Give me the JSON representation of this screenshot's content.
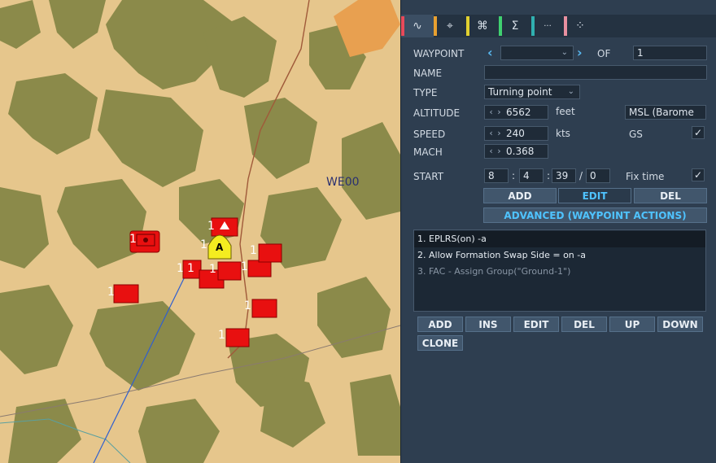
{
  "map": {
    "label_we00": "WE00",
    "unit_number": "1",
    "waypoint_marker": "A",
    "colors": {
      "sand": "#e6c68c",
      "vegetation": "#8b8a4a",
      "unit": "#e81010",
      "road": "#a05a3a",
      "route": "#2f5fd0"
    }
  },
  "tabs": [
    {
      "icon": "route-icon",
      "glyph": "∿",
      "color": "#e84a5a"
    },
    {
      "icon": "target-icon",
      "glyph": "⌖",
      "color": "#e8a030"
    },
    {
      "icon": "formation-icon",
      "glyph": "⌘",
      "color": "#e0d030"
    },
    {
      "icon": "sum-icon",
      "glyph": "Σ",
      "color": "#40d070"
    },
    {
      "icon": "dots-icon",
      "glyph": "···",
      "color": "#30b0b0"
    },
    {
      "icon": "scatter-icon",
      "glyph": "⁘",
      "color": "#e890a0"
    }
  ],
  "form": {
    "waypoint_label": "WAYPOINT",
    "waypoint_value": "",
    "of_label": "OF",
    "of_value": "1",
    "name_label": "NAME",
    "name_value": "",
    "type_label": "TYPE",
    "type_value": "Turning point",
    "altitude_label": "ALTITUDE",
    "altitude_value": "6562",
    "altitude_unit": "feet",
    "altitude_ref": "MSL (Barome",
    "speed_label": "SPEED",
    "speed_value": "240",
    "speed_unit": "kts",
    "gs_label": "GS",
    "mach_label": "MACH",
    "mach_value": "0.368",
    "start_label": "START",
    "start_h": "8",
    "start_m": "4",
    "start_s": "39",
    "start_d": "0",
    "fixtime_label": "Fix time",
    "check": "✓",
    "colon": ":",
    "slash": "/"
  },
  "wp_buttons": {
    "add": "ADD",
    "edit": "EDIT",
    "del": "DEL"
  },
  "advanced_button": "ADVANCED (WAYPOINT ACTIONS)",
  "actions": [
    {
      "text": "1. EPLRS(on)  -a"
    },
    {
      "text": "2. Allow Formation Swap Side = on -a"
    },
    {
      "text": "3. FAC - Assign Group(\"Ground-1\")"
    }
  ],
  "action_buttons": {
    "add": "ADD",
    "ins": "INS",
    "edit": "EDIT",
    "del": "DEL",
    "up": "UP",
    "down": "DOWN",
    "clone": "CLONE"
  }
}
